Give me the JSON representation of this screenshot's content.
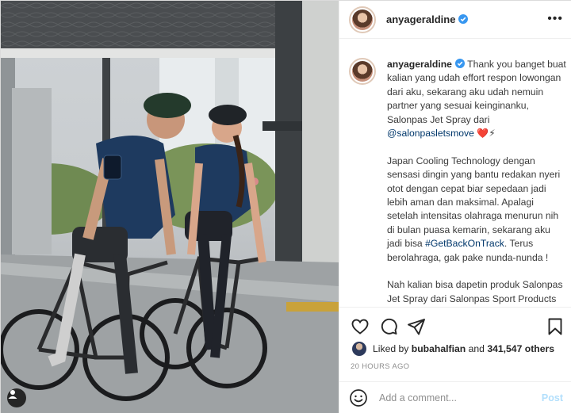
{
  "post": {
    "username": "anyageraldine",
    "more_label": "•••"
  },
  "caption": {
    "username": "anyageraldine",
    "p1_text": "Thank you banget buat kalian yang udah effort respon lowongan dari aku, sekarang aku udah nemuin partner yang sesuai keinginanku, Salonpas Jet Spray dari ",
    "p1_mention": "@salonpasletsmove",
    "p1_emoji": "❤️⚡",
    "p2_text_a": "Japan Cooling Technology dengan sensasi dingin yang bantu redakan nyeri otot dengan cepat biar sepedaan jadi lebih aman dan maksimal. Apalagi setelah intensitas olahraga menurun nih di bulan puasa kemarin, sekarang aku jadi bisa ",
    "p2_hashtag": "#GetBackOnTrack",
    "p2_text_b": ". Terus berolahraga, gak pake nunda-nunda !",
    "p3_text": "Nah kalian bisa dapetin produk Salonpas Jet Spray dari Salonpas Sport Products Lineup di Alfamart"
  },
  "likes": {
    "prefix": "Liked by ",
    "user": "bubahalfian",
    "middle": " and ",
    "count": "341,547 others"
  },
  "timestamp": "20 HOURS AGO",
  "comment": {
    "placeholder": "Add a comment...",
    "post_label": "Post"
  },
  "colors": {
    "verified": "#3897f0",
    "link": "#00376b",
    "post_button": "#b2dffc",
    "muted": "#8e8e8e"
  },
  "icons": [
    "verified-badge-icon",
    "more-options-icon",
    "heart-icon",
    "comment-icon",
    "share-icon",
    "bookmark-icon",
    "smiley-icon",
    "user-tag-icon"
  ]
}
